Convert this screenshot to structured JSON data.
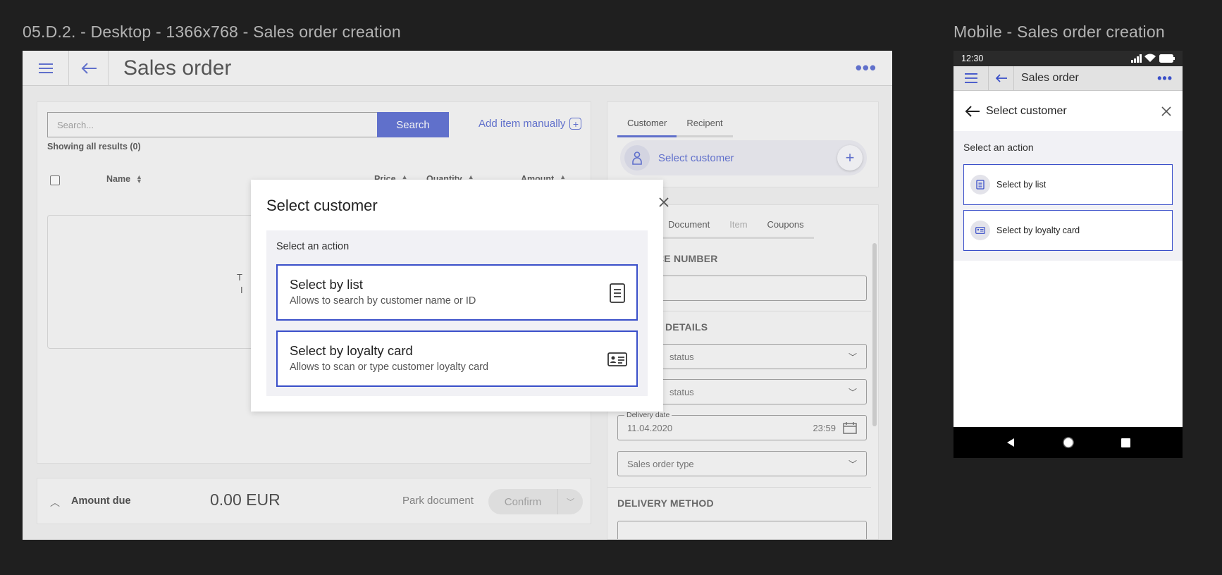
{
  "frames": {
    "desktop_title": "05.D.2. - Desktop - 1366x768 - Sales order creation",
    "mobile_title": "Mobile - Sales order creation"
  },
  "desktop": {
    "header": {
      "title": "Sales order"
    },
    "search": {
      "placeholder": "Search...",
      "button": "Search",
      "add_manual": "Add item manually",
      "results": "Showing all results (0)"
    },
    "table": {
      "columns": [
        "Name",
        "Price",
        "Quantity",
        "Amount"
      ],
      "empty_fragment_1": "T",
      "empty_fragment_2": "I"
    },
    "footer": {
      "amount_label": "Amount due",
      "amount_value": "0.00 EUR",
      "park": "Park document",
      "confirm": "Confirm"
    },
    "customer_panel": {
      "tabs": [
        "Customer",
        "Recipent"
      ],
      "select_customer": "Select customer"
    },
    "details_panel": {
      "tabs": [
        "Document",
        "Item",
        "Coupons"
      ],
      "reference_number": "CE NUMBER",
      "details_head": "DETAILS",
      "status_1": "status",
      "status_2": "status",
      "delivery_date_label": "Delivery date",
      "delivery_date": "11.04.2020",
      "delivery_time": "23:59",
      "sales_order_type": "Sales order type",
      "delivery_method": "DELIVERY METHOD"
    },
    "modal": {
      "title": "Select customer",
      "subtitle": "Select an action",
      "options": [
        {
          "title": "Select by list",
          "desc": "Allows to search by customer name or ID",
          "icon": "list-document-icon"
        },
        {
          "title": "Select by loyalty card",
          "desc": "Allows to scan or type customer loyalty card",
          "icon": "id-card-icon"
        }
      ]
    }
  },
  "mobile": {
    "status_time": "12:30",
    "appbar_title": "Sales order",
    "sheet_title": "Select customer",
    "subtitle": "Select an action",
    "options": [
      {
        "label": "Select by list",
        "icon": "list-document-icon"
      },
      {
        "label": "Select by loyalty card",
        "icon": "id-card-icon"
      }
    ]
  },
  "colors": {
    "accent": "#3a4fc9",
    "background": "#1f1f1f"
  }
}
